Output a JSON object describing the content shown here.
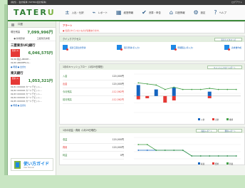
{
  "window": {
    "title": "(株式) - 会計帳簿 (TATERU会計帳簿)",
    "right": "ログアウト"
  },
  "brand": {
    "logo_main": "TATER",
    "logo_accent": "U"
  },
  "nav": [
    {
      "label": "入出・仕訳",
      "icon": "plus-minus-icon"
    },
    {
      "label": "レポート",
      "icon": "chart-icon"
    },
    {
      "label": "経営情報",
      "icon": "grid-icon"
    },
    {
      "label": "決算・申告",
      "icon": "check-icon"
    },
    {
      "label": "口座情報",
      "icon": "home-icon"
    },
    {
      "label": "設定",
      "icon": "gear-icon"
    },
    {
      "label": "ヘルプ",
      "icon": "help-icon"
    }
  ],
  "sidebar": {
    "section": "口座",
    "total_label": "現在残高",
    "total_amount": "7,099,996円",
    "links": [
      "● 新規登録",
      "口座残高詳細"
    ],
    "bank1": {
      "name": "三菱東京UFJ銀行",
      "badge": "普通 (1)",
      "amount": "6,046,575円",
      "txns": [
        "01/16  振込 ABCDE...",
        "01/20  ABCDEFG G..."
      ],
      "more": "● 明細 ● 出金を"
    },
    "bank2": {
      "name": "楽天銀行",
      "badge": "普通 (1)",
      "amount": "1,053,321円",
      "txns": [
        "01/21  XXXXXX  カードデビット...",
        "01/22  XXXXXX  カードデビット...",
        "01/23  XXXXXX  カードデビット...",
        "01/24  XXXXXX  カードデビット...",
        "01/25  XXXXXX  カードデビット..."
      ],
      "more": "● 明細 ● 出金を"
    },
    "guide": {
      "title": "使い方ガイド",
      "sub": "User Manual"
    }
  },
  "alert": {
    "title": "アラート",
    "text": "● 仕訳されていないものが多数あります。"
  },
  "quick": {
    "title": "クイックアクセス",
    "button": "表示カスタマイズ",
    "items": [
      "振替口座出金登録",
      "取引登録(手入力)",
      "明細取込(手入力)",
      "請求書作成"
    ]
  },
  "cashflow": {
    "title": "1月のキャッシュフロー（1月29日現在）",
    "button": "キャッシュフローレポート",
    "rows": [
      {
        "label": "入金",
        "value": "120,000円"
      },
      {
        "label": "出金",
        "value": "120,000円"
      },
      {
        "label": "今月残高",
        "value": "-112,562円"
      },
      {
        "label": "前月残高",
        "value": "-112,562円"
      }
    ],
    "legend": [
      "入金",
      "出金",
      "推移"
    ]
  },
  "expense": {
    "title": "1月の収益・費用（1月29日現在）",
    "button1": "収益レポート",
    "button2": "費用レポート",
    "rows": [
      {
        "label": "収益",
        "value": "120,000円"
      },
      {
        "label": "費用",
        "value": "120,000円"
      },
      {
        "label": "利益",
        "value": "0円"
      }
    ],
    "legend": [
      "収益",
      "費用",
      "利益"
    ]
  },
  "chart_data": [
    {
      "type": "bar",
      "categories": [
        "",
        "",
        "",
        "",
        "",
        "",
        "",
        "",
        "",
        "",
        "",
        ""
      ],
      "series": [
        {
          "name": "入金",
          "values": [
            100,
            0,
            60,
            0,
            80,
            0,
            0,
            0,
            40,
            0,
            0,
            0
          ]
        },
        {
          "name": "出金",
          "values": [
            -30,
            -20,
            0,
            -60,
            -40,
            0,
            0,
            0,
            -20,
            0,
            0,
            0
          ]
        },
        {
          "name": "推移",
          "values": [
            120,
            110,
            100,
            60,
            80,
            60,
            60,
            60,
            70,
            60,
            60,
            60
          ]
        }
      ],
      "ylim": [
        -150,
        200
      ]
    },
    {
      "type": "line",
      "categories": [
        "",
        "",
        "",
        "",
        "",
        "",
        "",
        "",
        "",
        "",
        "",
        ""
      ],
      "series": [
        {
          "name": "収益",
          "values": [
            60,
            60,
            60,
            60,
            60,
            60,
            20,
            20,
            20,
            20,
            20,
            20
          ]
        },
        {
          "name": "費用",
          "values": [
            100,
            100,
            60,
            60,
            60,
            60,
            20,
            20,
            20,
            20,
            20,
            20
          ]
        }
      ],
      "ylim": [
        0,
        150
      ]
    }
  ]
}
